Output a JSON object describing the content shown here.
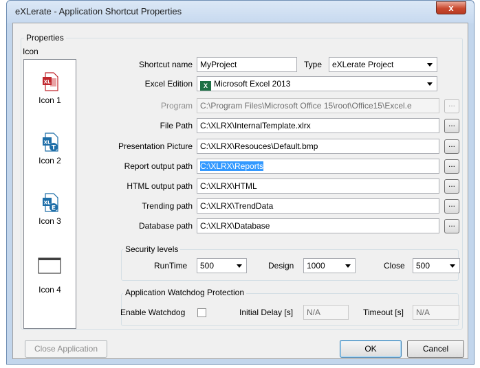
{
  "window": {
    "title": "eXLerate - Application Shortcut Properties",
    "close_glyph": "x"
  },
  "properties": {
    "legend": "Properties",
    "icon_label": "Icon",
    "icons": [
      {
        "label": "Icon 1",
        "glyph": "XL"
      },
      {
        "label": "Icon 2",
        "glyph": "XL",
        "badge": "T"
      },
      {
        "label": "Icon 3",
        "glyph": "XL",
        "badge": "E"
      },
      {
        "label": "Icon 4"
      }
    ],
    "shortcut_name_label": "Shortcut name",
    "shortcut_name": "MyProject",
    "type_label": "Type",
    "type_value": "eXLerate Project",
    "excel_edition_label": "Excel Edition",
    "excel_edition_value": "Microsoft Excel 2013",
    "program_label": "Program",
    "program_value": "C:\\Program Files\\Microsoft Office 15\\root\\Office15\\Excel.e",
    "file_path_label": "File Path",
    "file_path_value": "C:\\XLRX\\InternalTemplate.xlrx",
    "presentation_picture_label": "Presentation Picture",
    "presentation_picture_value": "C:\\XLRX\\Resouces\\Default.bmp",
    "report_output_label": "Report output path",
    "report_output_value": "C:\\XLRX\\Reports",
    "html_output_label": "HTML output path",
    "html_output_value": "C:\\XLRX\\HTML",
    "trending_label": "Trending path",
    "trending_value": "C:\\XLRX\\TrendData",
    "database_label": "Database path",
    "database_value": "C:\\XLRX\\Database",
    "browse_label": "..."
  },
  "security": {
    "legend": "Security levels",
    "runtime_label": "RunTime",
    "runtime_value": "500",
    "design_label": "Design",
    "design_value": "1000",
    "close_label": "Close",
    "close_value": "500"
  },
  "watchdog": {
    "legend": "Application Watchdog Protection",
    "enable_label": "Enable Watchdog",
    "initial_delay_label": "Initial Delay [s]",
    "initial_delay_value": "N/A",
    "timeout_label": "Timeout [s]",
    "timeout_value": "N/A"
  },
  "buttons": {
    "close_application": "Close Application",
    "ok": "OK",
    "cancel": "Cancel"
  },
  "colors": {
    "excel_green": "#1e7145",
    "icon_red": "#c0272d",
    "icon_blue": "#1d6ea8",
    "selection": "#3399ff"
  }
}
